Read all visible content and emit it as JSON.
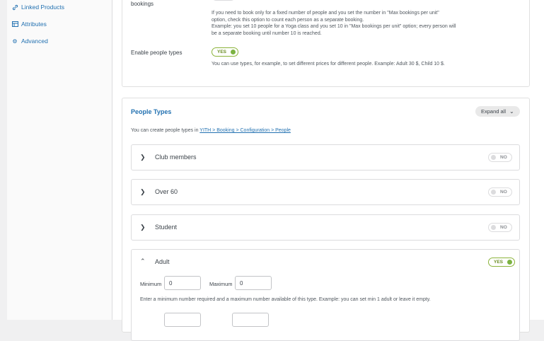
{
  "sidebar": {
    "items": [
      {
        "label": "Linked Products",
        "icon": "link-icon"
      },
      {
        "label": "Attributes",
        "icon": "table-icon"
      },
      {
        "label": "Advanced",
        "icon": "gear-icon"
      }
    ]
  },
  "settings": {
    "count_people": {
      "label": "Count people as separated bookings",
      "toggle": "NO",
      "desc_line1": "If you need to book only for a fixed number of people and you set the number in \"Max bookings per unit\"",
      "desc_line2": "option, check this option to count each person as a separate booking.",
      "desc_line3": "Example: you set 10 people for a Yoga class and you set 10 in \"Max bookings per unit\" option; every person will",
      "desc_line4": "be a separate booking until number 10 is reached."
    },
    "enable_people_types": {
      "label": "Enable people types",
      "toggle": "YES",
      "desc": "You can use types, for example, to set different prices for different people. Example: Adult 30 $, Child 10 $."
    }
  },
  "people_types": {
    "title": "People Types",
    "expand_label": "Expand all",
    "hint_prefix": "You can create people types in ",
    "hint_link": "YITH > Booking > Configuration > People",
    "types": [
      {
        "name": "Club members",
        "toggle": "NO"
      },
      {
        "name": "Over 60",
        "toggle": "NO"
      },
      {
        "name": "Student",
        "toggle": "NO"
      },
      {
        "name": "Adult",
        "toggle": "YES"
      }
    ],
    "adult": {
      "min_label": "Minimum",
      "min_value": "0",
      "max_label": "Maximum",
      "max_value": "0",
      "help": "Enter a minimum number required and a maximum number available of this type. Example: you can set min 1 adult or leave it empty."
    }
  },
  "colors": {
    "accent": "#2271b1",
    "toggle_on": "#7cb342"
  }
}
